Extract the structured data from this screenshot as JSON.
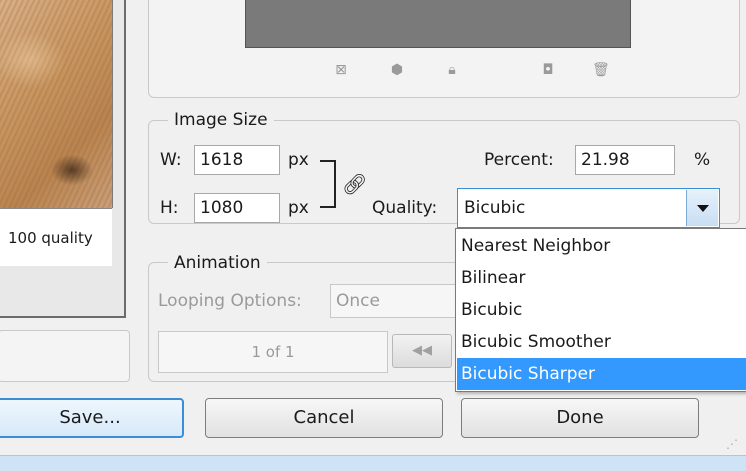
{
  "preview": {
    "caption": "100 quality"
  },
  "toolbar": {
    "icons": [
      "resize-icon",
      "3d-icon",
      "lock-icon",
      "new-icon",
      "trash-icon"
    ]
  },
  "image_size": {
    "legend": "Image Size",
    "width_label": "W:",
    "width_value": "1618",
    "width_unit": "px",
    "height_label": "H:",
    "height_value": "1080",
    "height_unit": "px",
    "percent_label": "Percent:",
    "percent_value": "21.98",
    "percent_unit": "%",
    "quality_label": "Quality:",
    "quality_value": "Bicubic",
    "quality_options": [
      "Nearest Neighbor",
      "Bilinear",
      "Bicubic",
      "Bicubic Smoother",
      "Bicubic Sharper"
    ],
    "highlighted_option": "Bicubic Sharper"
  },
  "animation": {
    "legend": "Animation",
    "looping_label": "Looping Options:",
    "looping_value": "Once",
    "frame_counter": "1 of 1"
  },
  "buttons": {
    "save": "Save...",
    "cancel": "Cancel",
    "done": "Done"
  },
  "colors": {
    "accent": "#3399ff",
    "focus_border": "#3a8ed6"
  }
}
